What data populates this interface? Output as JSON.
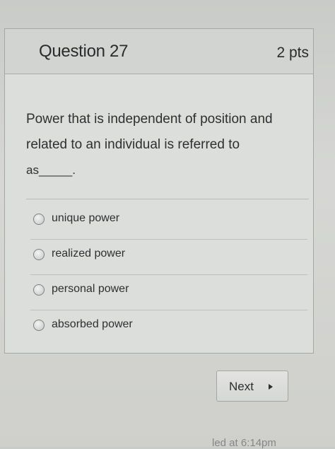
{
  "question": {
    "title": "Question 27",
    "points": "2 pts",
    "text_line1": "Power that is independent of position and",
    "text_line2": "related to an individual is referred to",
    "text_line3": "as_____."
  },
  "answers": [
    {
      "label": "unique power",
      "selected": false
    },
    {
      "label": "realized power",
      "selected": false
    },
    {
      "label": "personal power",
      "selected": false
    },
    {
      "label": "absorbed power",
      "selected": false
    }
  ],
  "navigation": {
    "next_label": "Next",
    "next_icon": "triangle-right-icon"
  },
  "footer": {
    "partial_text": "led at 6:14pm"
  }
}
